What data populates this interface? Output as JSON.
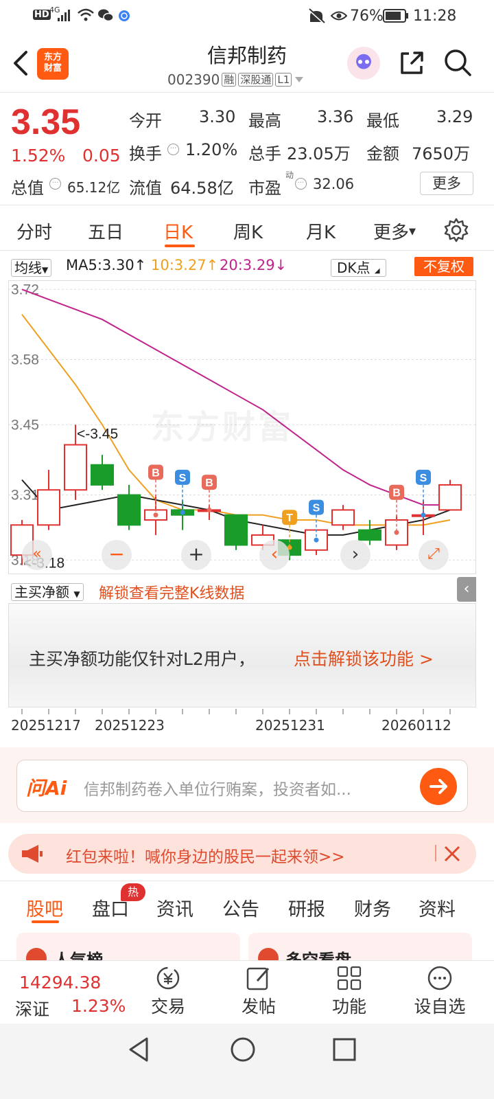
{
  "status_bar": {
    "net_label": "HD",
    "net_gen": "4G",
    "battery_pct": "76%",
    "time": "11:28"
  },
  "header": {
    "logo_text": "东方\n财富",
    "stock_name": "信邦制药",
    "stock_code": "002390",
    "tag_margin": "融",
    "tag_connect": "深股通",
    "tag_level": "L1"
  },
  "quote": {
    "price": "3.35",
    "change_pct": "1.52%",
    "change": "0.05",
    "open_label": "今开",
    "open": "3.30",
    "high_label": "最高",
    "high": "3.36",
    "low_label": "最低",
    "low": "3.29",
    "turnover_label": "换手",
    "turnover": "1.20%",
    "volume_label": "总手",
    "volume": "23.05万",
    "amount_label": "金额",
    "amount": "7650万",
    "total_cap_label": "总值",
    "total_cap": "65.12亿",
    "float_cap_label": "流值",
    "float_cap": "64.58亿",
    "pe_label": "市盈",
    "pe_sup": "动",
    "pe": "32.06",
    "more_button": "更多"
  },
  "chart_tabs": [
    "分时",
    "五日",
    "日K",
    "周K",
    "月K",
    "更多"
  ],
  "active_chart_tab": "日K",
  "indicator_row": {
    "ma_select": "均线",
    "ma5": "MA5:3.30↑",
    "ma10": "10:3.27↑",
    "ma20": "20:3.29↓",
    "dk_select": "DK点",
    "fq_button": "不复权",
    "ma5_color": "#222222",
    "ma10_color": "#f0a020",
    "ma20_color": "#c0248c"
  },
  "chart_data": {
    "type": "candlestick",
    "y_ticks": [
      "3.72",
      "3.58",
      "3.45",
      "3.31",
      "3.18"
    ],
    "ylim": [
      3.16,
      3.73
    ],
    "max_annotation": "<-3.45",
    "min_annotation": "<-3.18",
    "watermark": "东方财富",
    "x_labels": [
      "20251217",
      "20251223",
      "20251231",
      "20260112"
    ],
    "candles": [
      {
        "o": 3.19,
        "c": 3.25,
        "h": 3.26,
        "l": 3.17
      },
      {
        "o": 3.25,
        "c": 3.32,
        "h": 3.36,
        "l": 3.24
      },
      {
        "o": 3.32,
        "c": 3.41,
        "h": 3.45,
        "l": 3.3
      },
      {
        "o": 3.37,
        "c": 3.33,
        "h": 3.39,
        "l": 3.32
      },
      {
        "o": 3.31,
        "c": 3.25,
        "h": 3.33,
        "l": 3.24
      },
      {
        "o": 3.26,
        "c": 3.28,
        "h": 3.31,
        "l": 3.23
      },
      {
        "o": 3.28,
        "c": 3.27,
        "h": 3.3,
        "l": 3.24
      },
      {
        "o": 3.28,
        "c": 3.28,
        "h": 3.29,
        "l": 3.26
      },
      {
        "o": 3.27,
        "c": 3.21,
        "h": 3.27,
        "l": 3.2
      },
      {
        "o": 3.21,
        "c": 3.23,
        "h": 3.25,
        "l": 3.2
      },
      {
        "o": 3.22,
        "c": 3.19,
        "h": 3.22,
        "l": 3.18
      },
      {
        "o": 3.2,
        "c": 3.24,
        "h": 3.24,
        "l": 3.19
      },
      {
        "o": 3.25,
        "c": 3.28,
        "h": 3.29,
        "l": 3.24
      },
      {
        "o": 3.24,
        "c": 3.22,
        "h": 3.26,
        "l": 3.21
      },
      {
        "o": 3.21,
        "c": 3.26,
        "h": 3.27,
        "l": 3.2
      },
      {
        "o": 3.27,
        "c": 3.27,
        "h": 3.3,
        "l": 3.23
      },
      {
        "o": 3.28,
        "c": 3.33,
        "h": 3.34,
        "l": 3.28
      }
    ],
    "ma5": [
      3.34,
      3.28,
      3.29,
      3.3,
      3.31,
      3.3,
      3.29,
      3.28,
      3.26,
      3.25,
      3.24,
      3.23,
      3.23,
      3.24,
      3.25,
      3.26,
      3.28
    ],
    "ma10": [
      3.67,
      3.6,
      3.53,
      3.45,
      3.36,
      3.3,
      3.28,
      3.28,
      3.27,
      3.27,
      3.26,
      3.26,
      3.25,
      3.25,
      3.25,
      3.25,
      3.26
    ],
    "ma20": [
      3.72,
      3.7,
      3.68,
      3.66,
      3.63,
      3.6,
      3.57,
      3.54,
      3.51,
      3.48,
      3.44,
      3.4,
      3.36,
      3.33,
      3.31,
      3.29,
      3.29
    ],
    "signals": [
      {
        "i": 5,
        "t": "B"
      },
      {
        "i": 6,
        "t": "S"
      },
      {
        "i": 7,
        "t": "B"
      },
      {
        "i": 10,
        "t": "T"
      },
      {
        "i": 11,
        "t": "S"
      },
      {
        "i": 14,
        "t": "B"
      },
      {
        "i": 15,
        "t": "S"
      }
    ]
  },
  "lower_panel": {
    "select": "主买净额",
    "unlock_link": "解锁查看完整K线数据",
    "message": "主买净额功能仅针对L2用户，",
    "message_link": "点击解锁该功能 >"
  },
  "ai_bar": {
    "logo": "问Ai",
    "placeholder": "信邦制药卷入单位行贿案，投资者如..."
  },
  "banner": {
    "text": "红包来啦！喊你身边的股民一起来领>>"
  },
  "bottom_tabs": [
    "股吧",
    "盘口",
    "资讯",
    "公告",
    "研报",
    "财务",
    "资料"
  ],
  "hot_badge": "热",
  "cards": [
    {
      "title": "人气榜"
    },
    {
      "title": "多空看盘"
    }
  ],
  "bottom_nav": {
    "index_value": "14294.38",
    "index_name": "深证",
    "index_change": "1.23%",
    "items": [
      "交易",
      "发帖",
      "功能",
      "设自选"
    ]
  }
}
